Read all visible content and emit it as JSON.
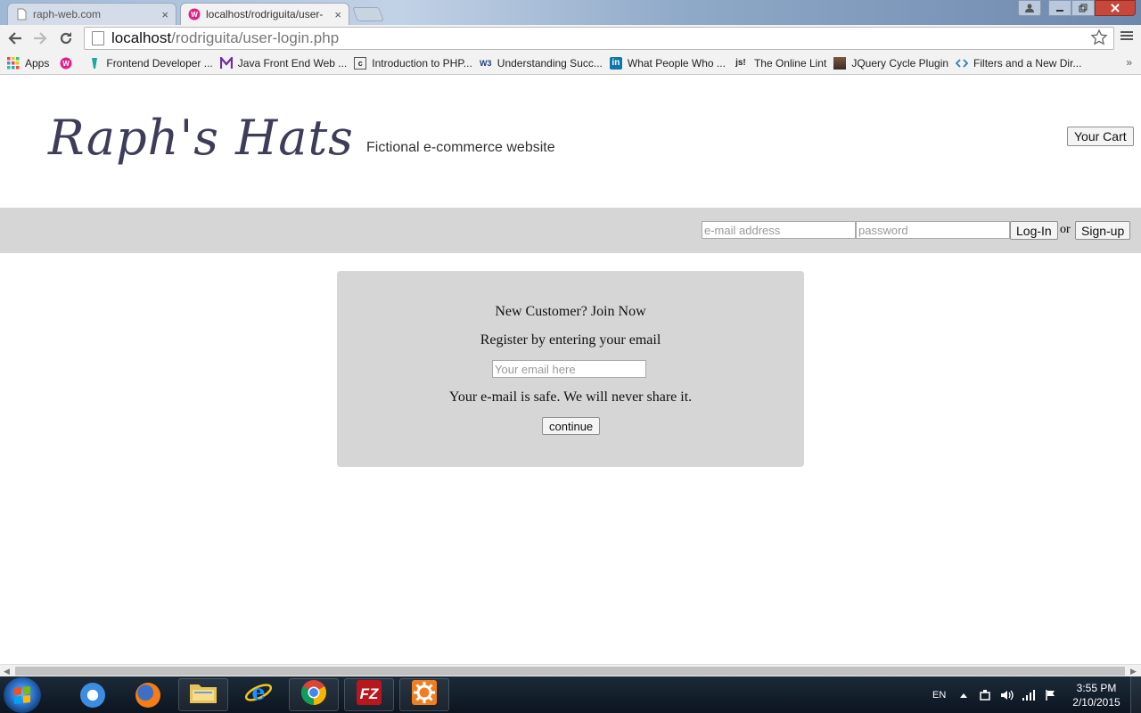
{
  "browser": {
    "tabs": [
      {
        "label": "raph-web.com",
        "close": "×"
      },
      {
        "label": "localhost/rodriguita/user-",
        "close": "×"
      }
    ],
    "address": {
      "host": "localhost",
      "path": "/rodriguita/user-login.php"
    },
    "bookmarks": [
      {
        "label": "Apps",
        "icon": "apps-grid-icon"
      },
      {
        "label": "",
        "icon": "web-app-icon"
      },
      {
        "label": "Frontend Developer ...",
        "icon": "treehouse-icon"
      },
      {
        "label": "Java Front End Web ...",
        "icon": "m-icon"
      },
      {
        "label": "Introduction to PHP...",
        "icon": "page-icon"
      },
      {
        "label": "Understanding Succ...",
        "icon": "w3-icon"
      },
      {
        "label": "What People Who ...",
        "icon": "linkedin-icon"
      },
      {
        "label": "The Online Lint",
        "icon": "jsl-icon"
      },
      {
        "label": "JQuery Cycle Plugin",
        "icon": "photo-icon"
      },
      {
        "label": "Filters and a New Dir...",
        "icon": "code-icon"
      }
    ],
    "bookmark_icon_text": {
      "w3": "W3",
      "linkedin": "in",
      "jsl": "js!",
      "page": "c"
    },
    "more": "»"
  },
  "site": {
    "logo": "Raph's Hats",
    "tagline": "Fictional e-commerce website",
    "cart_button": "Your Cart"
  },
  "login": {
    "email_placeholder": "e-mail address",
    "password_placeholder": "password",
    "login_button": "Log-In",
    "or": "or",
    "signup_button": "Sign-up"
  },
  "join": {
    "title": "New Customer? Join Now",
    "subtitle": "Register by entering your email",
    "email_placeholder": "Your email here",
    "note": "Your e-mail is safe. We will never share it.",
    "continue_button": "continue"
  },
  "taskbar": {
    "language": "EN",
    "time": "3:55 PM",
    "date": "2/10/2015"
  },
  "colors": {
    "login_bar": "#d6d6d6",
    "panel": "#d6d6d6",
    "logo": "#3d3d5a",
    "close_button": "#c7483a"
  }
}
